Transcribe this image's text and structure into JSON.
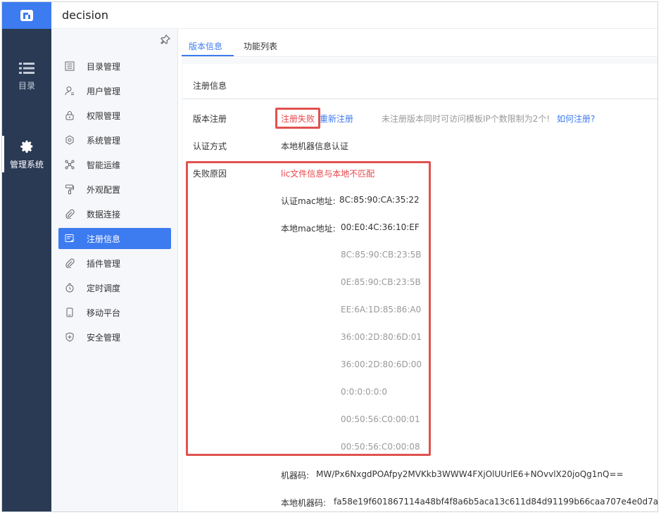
{
  "app": {
    "title": "decision"
  },
  "rail": {
    "items": [
      {
        "label": "目录",
        "icon": "list-icon"
      },
      {
        "label": "管理系统",
        "icon": "gear-icon"
      }
    ]
  },
  "submenu": {
    "items": [
      {
        "label": "目录管理",
        "icon": "catalog-icon"
      },
      {
        "label": "用户管理",
        "icon": "user-icon"
      },
      {
        "label": "权限管理",
        "icon": "lock-icon"
      },
      {
        "label": "系统管理",
        "icon": "settings-icon"
      },
      {
        "label": "智能运维",
        "icon": "network-icon"
      },
      {
        "label": "外观配置",
        "icon": "paint-roller-icon"
      },
      {
        "label": "数据连接",
        "icon": "paperclip-icon"
      },
      {
        "label": "注册信息",
        "icon": "register-icon"
      },
      {
        "label": "插件管理",
        "icon": "plugin-icon"
      },
      {
        "label": "定时调度",
        "icon": "timer-icon"
      },
      {
        "label": "移动平台",
        "icon": "mobile-icon"
      },
      {
        "label": "安全管理",
        "icon": "shield-icon"
      }
    ],
    "active_index": 7
  },
  "tabs": [
    {
      "label": "版本信息"
    },
    {
      "label": "功能列表"
    }
  ],
  "register": {
    "section_title": "注册信息",
    "version_label": "版本注册",
    "status": "注册失败",
    "re_register": "重新注册",
    "notice": "未注册版本同时可访问模板IP个数限制为2个!",
    "how_link": "如何注册?",
    "auth_label": "认证方式",
    "auth_value": "本地机器信息认证",
    "fail_label": "失败原因",
    "fail_reason": "lic文件信息与本地不匹配",
    "auth_mac_label": "认证mac地址:",
    "auth_mac": "8C:85:90:CA:35:22",
    "local_mac_label": "本地mac地址:",
    "local_macs": [
      "00:E0:4C:36:10:EF",
      "8C:85:90:CB:23:5B",
      "0E:85:90:CB:23:5B",
      "EE:6A:1D:85:86:A0",
      "36:00:2D:80:6D:01",
      "36:00:2D:80:6D:00",
      "0:0:0:0:0:0",
      "00:50:56:C0:00:01",
      "00:50:56:C0:00:08"
    ],
    "machine_code_label": "机器码:",
    "machine_code": "MW/Px6NxgdPOAfpy2MVKkb3WWW4FXjOlUUrlE6+NOvvlX20joQg1nQ==",
    "local_machine_code_label": "本地机器码:",
    "local_machine_code": "fa58e19f601867114a48bf4f8a6b5aca13c611d84d91199b66caa707e4e0d7a4"
  },
  "colors": {
    "accent": "#3d7bf0",
    "rail_bg": "#2a3a54",
    "error": "#e8454a",
    "highlight_box": "#e0524f"
  }
}
